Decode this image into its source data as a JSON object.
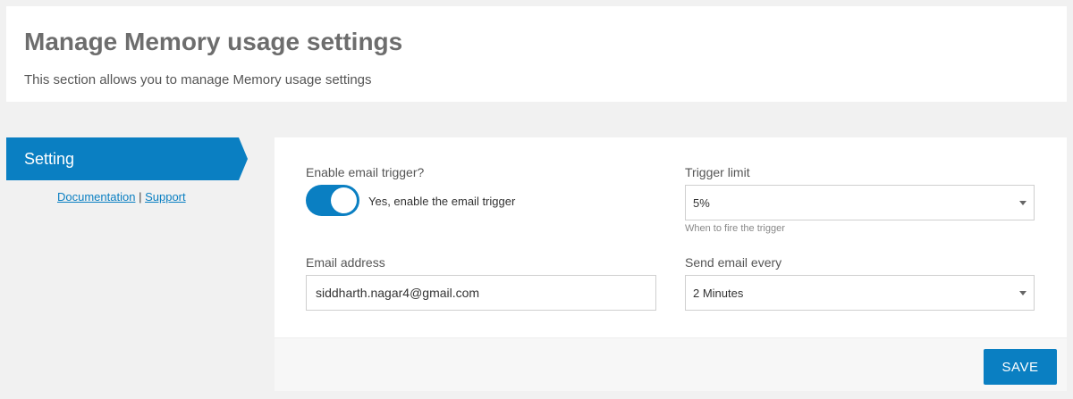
{
  "header": {
    "title": "Manage Memory usage settings",
    "subtitle": "This section allows you to manage Memory usage settings"
  },
  "sidebar": {
    "active_tab": "Setting",
    "documentation_link": "Documentation",
    "separator": "|",
    "support_link": "Support"
  },
  "form": {
    "email_trigger": {
      "label": "Enable email trigger?",
      "enabled": true,
      "toggle_text": "Yes, enable the email trigger"
    },
    "trigger_limit": {
      "label": "Trigger limit",
      "value": "5%",
      "help": "When to fire the trigger"
    },
    "email_address": {
      "label": "Email address",
      "value": "siddharth.nagar4@gmail.com"
    },
    "send_every": {
      "label": "Send email every",
      "value": "2 Minutes"
    },
    "save_label": "SAVE"
  },
  "colors": {
    "accent": "#0a7fc2",
    "background": "#f1f1f1"
  }
}
